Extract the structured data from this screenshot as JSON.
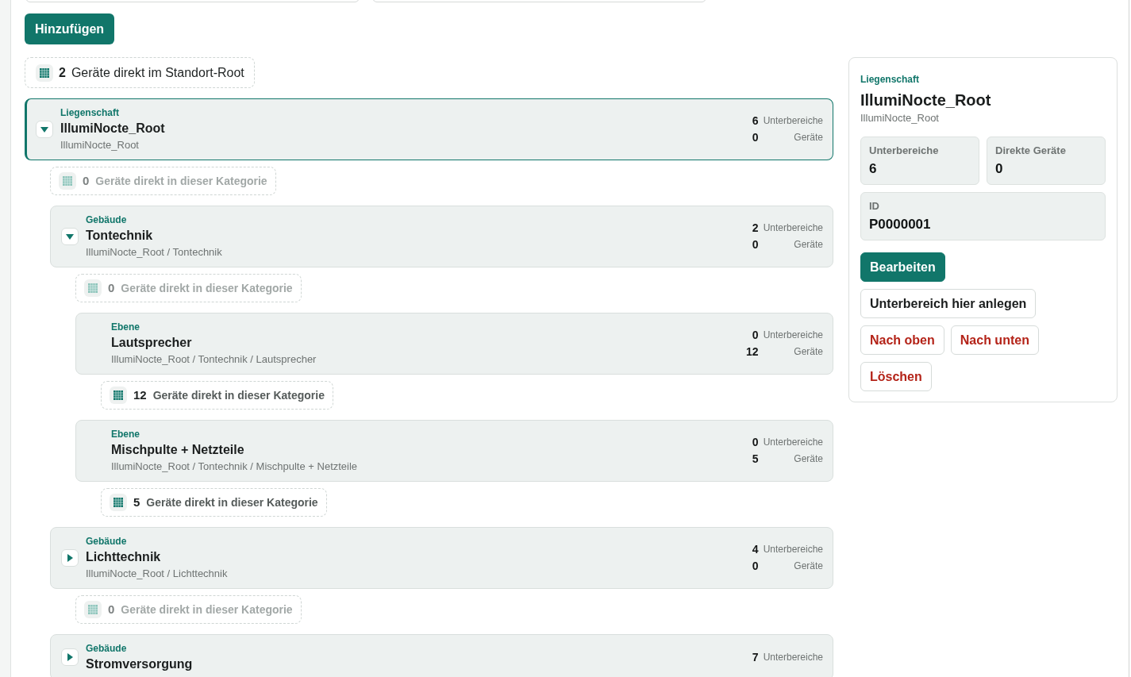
{
  "top_fields": [
    {
      "kind": "input"
    },
    {
      "kind": "input"
    }
  ],
  "add_button": "Hinzufügen",
  "root_devices": {
    "count": "2",
    "label": "Geräte direkt im Standort-Root"
  },
  "tree": [
    {
      "type_label": "Liegenschaft",
      "name": "IllumiNocte_Root",
      "path": "IllumiNocte_Root",
      "selected": true,
      "has_children": true,
      "expanded": true,
      "counts": {
        "numbers": [
          "6",
          "0"
        ],
        "labels": [
          "Unterbereiche",
          "Geräte"
        ]
      },
      "direct_devices": {
        "count": "0",
        "label": "Geräte direkt in dieser Kategorie",
        "dimmed": true
      },
      "children": [
        {
          "type_label": "Gebäude",
          "name": "Tontechnik",
          "path": "IllumiNocte_Root / Tontechnik",
          "selected": false,
          "has_children": true,
          "expanded": true,
          "counts": {
            "numbers": [
              "2",
              "0"
            ],
            "labels": [
              "Unterbereiche",
              "Geräte"
            ]
          },
          "direct_devices": {
            "count": "0",
            "label": "Geräte direkt in dieser Kategorie",
            "dimmed": true
          },
          "children": [
            {
              "type_label": "Ebene",
              "name": "Lautsprecher",
              "path": "IllumiNocte_Root / Tontechnik / Lautsprecher",
              "selected": false,
              "has_children": false,
              "counts": {
                "numbers": [
                  "0",
                  "12"
                ],
                "labels": [
                  "Unterbereiche",
                  "Geräte"
                ]
              },
              "direct_devices": {
                "count": "12",
                "label": "Geräte direkt in dieser Kategorie",
                "dimmed": false
              }
            },
            {
              "type_label": "Ebene",
              "name": "Mischpulte + Netzteile",
              "path": "IllumiNocte_Root / Tontechnik / Mischpulte + Netzteile",
              "selected": false,
              "has_children": false,
              "counts": {
                "numbers": [
                  "0",
                  "5"
                ],
                "labels": [
                  "Unterbereiche",
                  "Geräte"
                ]
              },
              "direct_devices": {
                "count": "5",
                "label": "Geräte direkt in dieser Kategorie",
                "dimmed": false
              }
            }
          ]
        },
        {
          "type_label": "Gebäude",
          "name": "Lichttechnik",
          "path": "IllumiNocte_Root / Lichttechnik",
          "selected": false,
          "has_children": true,
          "expanded": false,
          "counts": {
            "numbers": [
              "4",
              "0"
            ],
            "labels": [
              "Unterbereiche",
              "Geräte"
            ]
          },
          "direct_devices": {
            "count": "0",
            "label": "Geräte direkt in dieser Kategorie",
            "dimmed": true
          }
        },
        {
          "type_label": "Gebäude",
          "name": "Stromversorgung",
          "selected": false,
          "has_children": true,
          "expanded": false,
          "counts": {
            "numbers": [
              "7"
            ],
            "labels": [
              "Unterbereiche"
            ]
          }
        }
      ]
    }
  ],
  "details": {
    "type_label": "Liegenschaft",
    "title": "IllumiNocte_Root",
    "path": "IllumiNocte_Root",
    "stats": [
      {
        "label": "Unterbereiche",
        "value": "6",
        "wide": false
      },
      {
        "label": "Direkte Geräte",
        "value": "0",
        "wide": false
      },
      {
        "label": "ID",
        "value": "P0000001",
        "wide": true
      }
    ],
    "action_rows": [
      {
        "buttons": [
          {
            "label": "Bearbeiten",
            "kind": "primary"
          }
        ]
      },
      {
        "buttons": [
          {
            "label": "Unterbereich hier anlegen",
            "kind": "secondary"
          }
        ]
      },
      {
        "buttons": [
          {
            "label": "Nach oben",
            "kind": "danger"
          },
          {
            "label": "Nach unten",
            "kind": "danger"
          }
        ]
      },
      {
        "buttons": [
          {
            "label": "Löschen",
            "kind": "danger"
          }
        ]
      }
    ]
  }
}
